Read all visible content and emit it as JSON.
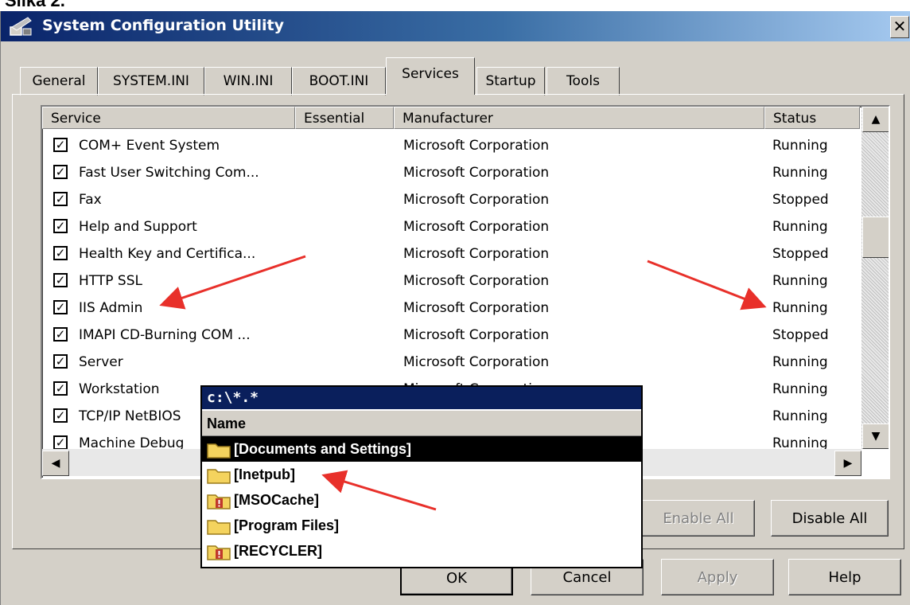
{
  "caption": "Slika 2.",
  "window": {
    "title": "System Configuration Utility",
    "close_label": "✕"
  },
  "tabs": [
    {
      "label": "General"
    },
    {
      "label": "SYSTEM.INI"
    },
    {
      "label": "WIN.INI"
    },
    {
      "label": "BOOT.INI"
    },
    {
      "label": "Services",
      "active": true
    },
    {
      "label": "Startup"
    },
    {
      "label": "Tools"
    }
  ],
  "services": {
    "columns": [
      "Service",
      "Essential",
      "Manufacturer",
      "Status"
    ],
    "rows": [
      {
        "checked": true,
        "service": "COM+ Event System",
        "essential": "",
        "manufacturer": "Microsoft Corporation",
        "status": "Running"
      },
      {
        "checked": true,
        "service": "Fast User Switching Com...",
        "essential": "",
        "manufacturer": "Microsoft Corporation",
        "status": "Running"
      },
      {
        "checked": true,
        "service": "Fax",
        "essential": "",
        "manufacturer": "Microsoft Corporation",
        "status": "Stopped"
      },
      {
        "checked": true,
        "service": "Help and Support",
        "essential": "",
        "manufacturer": "Microsoft Corporation",
        "status": "Running"
      },
      {
        "checked": true,
        "service": "Health Key and Certifica...",
        "essential": "",
        "manufacturer": "Microsoft Corporation",
        "status": "Stopped"
      },
      {
        "checked": true,
        "service": "HTTP SSL",
        "essential": "",
        "manufacturer": "Microsoft Corporation",
        "status": "Running"
      },
      {
        "checked": true,
        "service": "IIS Admin",
        "essential": "",
        "manufacturer": "Microsoft Corporation",
        "status": "Running"
      },
      {
        "checked": true,
        "service": "IMAPI CD-Burning COM ...",
        "essential": "",
        "manufacturer": "Microsoft Corporation",
        "status": "Stopped"
      },
      {
        "checked": true,
        "service": "Server",
        "essential": "",
        "manufacturer": "Microsoft Corporation",
        "status": "Running"
      },
      {
        "checked": true,
        "service": "Workstation",
        "essential": "",
        "manufacturer": "Microsoft Corporation",
        "status": "Running"
      },
      {
        "checked": true,
        "service": "TCP/IP NetBIOS",
        "essential": "",
        "manufacturer": "",
        "status": "Running"
      },
      {
        "checked": true,
        "service": "Machine Debug",
        "essential": "",
        "manufacturer": "",
        "status": "Running"
      }
    ]
  },
  "buttons": {
    "enable_all": "Enable All",
    "disable_all": "Disable All",
    "ok": "OK",
    "cancel": "Cancel",
    "apply": "Apply",
    "help": "Help"
  },
  "file_popup": {
    "path": "c:\\*.*",
    "header": "Name",
    "items": [
      {
        "name": "[Documents and Settings]",
        "selected": true,
        "warning": false
      },
      {
        "name": "[Inetpub]",
        "selected": false,
        "warning": false
      },
      {
        "name": "[MSOCache]",
        "selected": false,
        "warning": true
      },
      {
        "name": "[Program Files]",
        "selected": false,
        "warning": false
      },
      {
        "name": "[RECYCLER]",
        "selected": false,
        "warning": true
      }
    ]
  },
  "colors": {
    "titlebar": "#0a246a",
    "arrow": "#e8302a",
    "selection": "#000000"
  }
}
